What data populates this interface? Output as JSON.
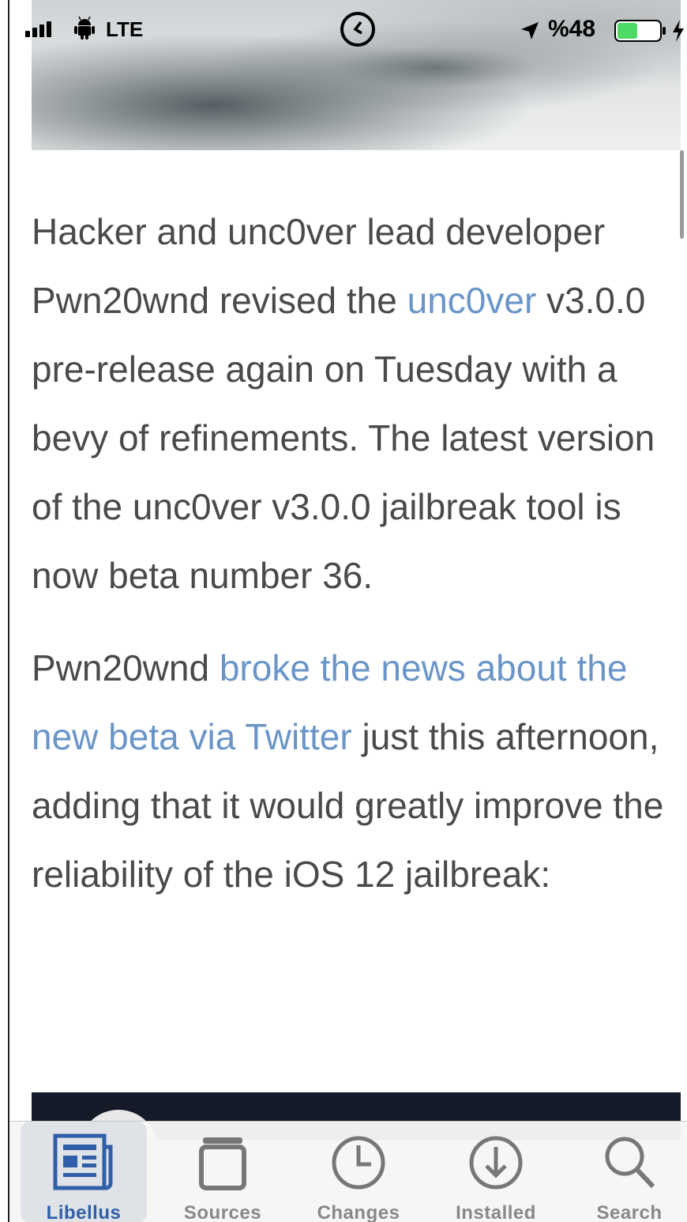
{
  "status_bar": {
    "carrier": "LTE",
    "battery_percent": "%48",
    "battery_level": 0.48,
    "icons": [
      "signal-icon",
      "android-icon",
      "alarm-clock-icon",
      "location-arrow-icon",
      "battery-icon",
      "charging-bolt-icon"
    ]
  },
  "article": {
    "p1_text1": "Hacker and unc0ver lead developer Pwn20wnd revised the ",
    "p1_link": "unc0ver",
    "p1_text2": " v3.0.0 pre-release again on Tuesday with a bevy of refinements. The latest version of the unc0ver v3.0.0 jailbreak tool is now beta number 36.",
    "p2_text1": "Pwn20wnd ",
    "p2_link": "broke the news about the new beta via Twitter",
    "p2_text2": " just this afternoon, adding that it would greatly improve the reliability of the iOS 12 jailbreak:"
  },
  "tabs": [
    {
      "label": "Libellus",
      "icon": "newspaper-icon",
      "active": true
    },
    {
      "label": "Sources",
      "icon": "sources-icon",
      "active": false
    },
    {
      "label": "Changes",
      "icon": "clock-icon",
      "active": false
    },
    {
      "label": "Installed",
      "icon": "download-icon",
      "active": false
    },
    {
      "label": "Search",
      "icon": "search-icon",
      "active": false
    }
  ],
  "colors": {
    "link": "#6a95c8",
    "active_tab": "#2f5fa8",
    "inactive_tab": "#888888",
    "battery_fill": "#4cd964"
  }
}
